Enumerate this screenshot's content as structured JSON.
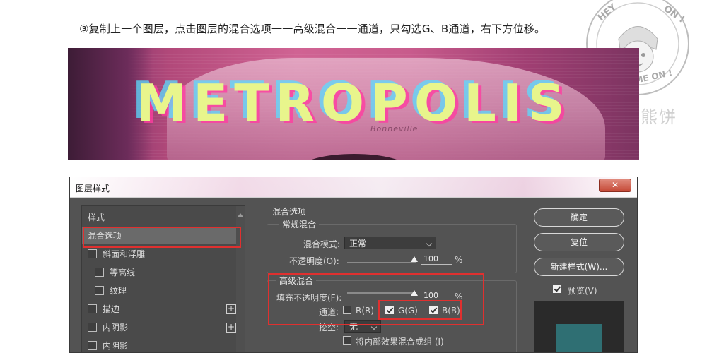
{
  "caption": "③复制上一个图层，点击图层的混合选项一一高级混合一一通道，只勾选G、B通道，右下方位移。",
  "watermark": "嘉鹏小熊饼",
  "stamp": {
    "top_text": "HEY",
    "mid_text": "ON !",
    "bottom_text": "COME ON !"
  },
  "banner": {
    "title": "METROPOLIS",
    "script": "Bonneville"
  },
  "dialog": {
    "title": "图层样式",
    "close_label": "✕",
    "left_panel": {
      "header": "样式",
      "items": [
        {
          "label": "混合选项",
          "has_checkbox": false,
          "has_plus": false,
          "indent": false,
          "selected": true
        },
        {
          "label": "斜面和浮雕",
          "has_checkbox": true,
          "has_plus": false,
          "indent": false
        },
        {
          "label": "等高线",
          "has_checkbox": true,
          "has_plus": false,
          "indent": true
        },
        {
          "label": "纹理",
          "has_checkbox": true,
          "has_plus": false,
          "indent": true
        },
        {
          "label": "描边",
          "has_checkbox": true,
          "has_plus": true,
          "indent": false
        },
        {
          "label": "内阴影",
          "has_checkbox": true,
          "has_plus": true,
          "indent": false
        },
        {
          "label": "内阴影",
          "has_checkbox": true,
          "has_plus": false,
          "indent": false
        }
      ],
      "plus_symbol": "+"
    },
    "blend_options": {
      "section_title": "混合选项",
      "general": {
        "title": "常规混合",
        "mode_label": "混合模式:",
        "mode_value": "正常",
        "opacity_label": "不透明度(O):",
        "opacity_value": "100",
        "opacity_unit": "%"
      },
      "advanced": {
        "title": "高级混合",
        "fill_label": "填充不透明度(F):",
        "fill_value": "100",
        "fill_unit": "%",
        "channels_label": "通道:",
        "channels": [
          {
            "label": "R(R)",
            "checked": false
          },
          {
            "label": "G(G)",
            "checked": true
          },
          {
            "label": "B(B)",
            "checked": true
          }
        ],
        "knockout_label": "挖空:",
        "knockout_value": "无",
        "blend_interior_label": "将内部效果混合成组 (I)"
      }
    },
    "buttons": {
      "ok": "确定",
      "reset": "复位",
      "new_style": "新建样式(W)...",
      "preview": "预览(V)"
    }
  },
  "colors": {
    "highlight_border": "#e0302f",
    "dialog_bg": "#535353"
  }
}
